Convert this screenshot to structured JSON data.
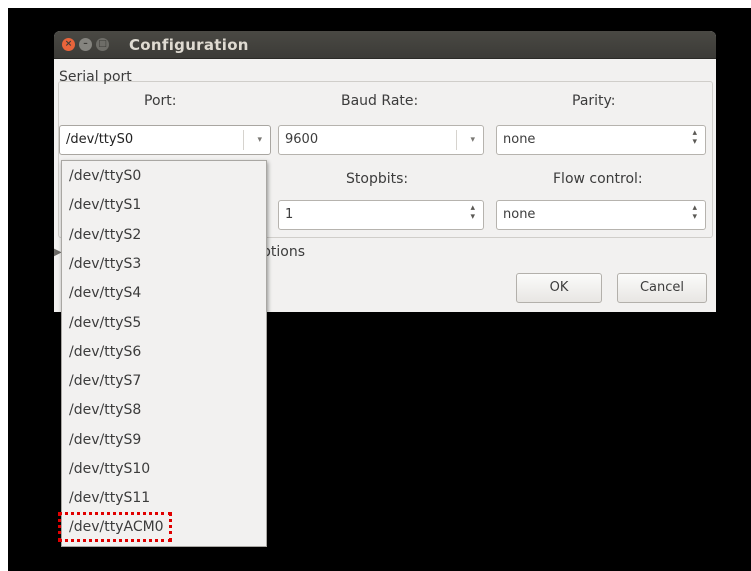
{
  "window": {
    "title": "Configuration",
    "controls": {
      "close": "×",
      "minimize": "–",
      "maximize": "□"
    }
  },
  "serial_port": {
    "group_label": "Serial port",
    "port": {
      "label": "Port:",
      "value": "/dev/ttyS0"
    },
    "baud_rate": {
      "label": "Baud Rate:",
      "value": "9600"
    },
    "parity": {
      "label": "Parity:",
      "value": "none"
    },
    "stopbits": {
      "label": "Stopbits:",
      "value": "1"
    },
    "flow_control": {
      "label": "Flow control:",
      "value": "none"
    }
  },
  "advanced": {
    "label_visible": "ptions"
  },
  "buttons": {
    "ok": "OK",
    "cancel": "Cancel"
  },
  "port_options": [
    "/dev/ttyS0",
    "/dev/ttyS1",
    "/dev/ttyS2",
    "/dev/ttyS3",
    "/dev/ttyS4",
    "/dev/ttyS5",
    "/dev/ttyS6",
    "/dev/ttyS7",
    "/dev/ttyS8",
    "/dev/ttyS9",
    "/dev/ttyS10",
    "/dev/ttyS11",
    "/dev/ttyACM0"
  ],
  "icons": {
    "dropdown_arrow": "▾",
    "spin_up": "▴",
    "spin_down": "▾",
    "expander": "▶"
  },
  "colors": {
    "highlight": "#e00000",
    "titlebar": "#3c3b37",
    "close_button": "#e9643b"
  }
}
